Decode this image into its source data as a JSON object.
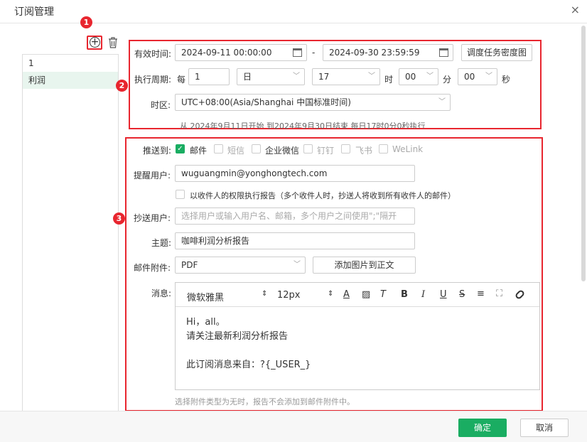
{
  "dialog": {
    "title": "订阅管理",
    "close": "×"
  },
  "annotations": [
    "1",
    "2",
    "3"
  ],
  "list": {
    "items": [
      "1",
      "利润"
    ]
  },
  "schedule": {
    "valid_label": "有效时间:",
    "start": "2024-09-11 00:00:00",
    "dash": "-",
    "end": "2024-09-30 23:59:59",
    "density_button": "调度任务密度图",
    "period_label": "执行周期:",
    "every": "每",
    "every_value": "1",
    "unit": "日",
    "hour": "17",
    "hour_unit": "时",
    "minute": "00",
    "minute_unit": "分",
    "second": "00",
    "second_unit": "秒",
    "tz_label": "时区:",
    "tz_value": "UTC+08:00(Asia/Shanghai 中国标准时间)",
    "summary": "从 2024年9月11日开始 到2024年9月30日结束 每日17时0分0秒执行"
  },
  "push": {
    "label": "推送到:",
    "channels": [
      {
        "name": "邮件",
        "checked": true
      },
      {
        "name": "短信",
        "checked": false
      },
      {
        "name": "企业微信",
        "checked": false
      },
      {
        "name": "钉钉",
        "checked": false
      },
      {
        "name": "飞书",
        "checked": false
      },
      {
        "name": "WeLink",
        "checked": false
      }
    ],
    "remind_label": "提醒用户:",
    "remind_value": "wuguangmin@yonghongtech.com",
    "perm_option": "以收件人的权限执行报告（多个收件人时，抄送人将收到所有收件人的邮件）",
    "cc_label": "抄送用户:",
    "cc_placeholder": "选择用户或输入用户名、邮箱，多个用户之间使用\";\"隔开",
    "subject_label": "主题:",
    "subject_value": "咖啡利润分析报告",
    "attach_label": "邮件附件:",
    "attach_value": "PDF",
    "add_image_button": "添加图片到正文",
    "message_label": "消息:",
    "font": "微软雅黑",
    "size": "12px",
    "body_lines": [
      "Hi，all。",
      "请关注最新利润分析报告",
      "",
      "此订阅消息来自：?{_USER_}"
    ],
    "hint": "选择附件类型为无时，报告不会添加到邮件附件中。"
  },
  "footer": {
    "ok": "确定",
    "cancel": "取消"
  }
}
